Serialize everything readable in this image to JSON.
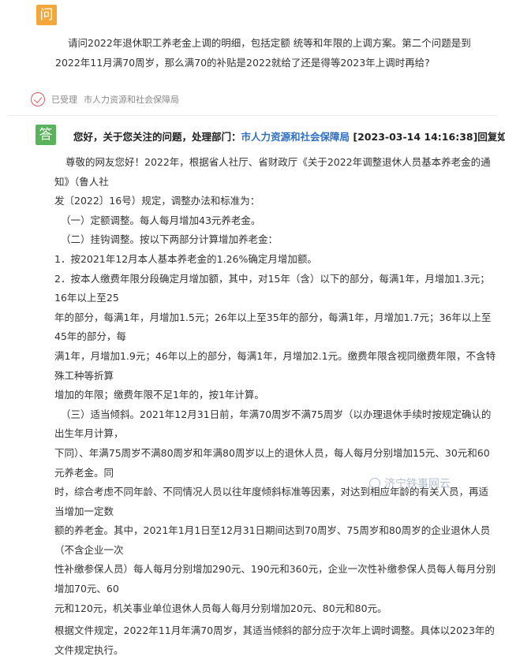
{
  "question": {
    "badge": "问",
    "lines": [
      "请问2022年退休职工养老金上调的明细，包括定额 统等和年限的上调方案。第二个问题是到2022年11月满70周",
      "岁，那么满70的补贴是2022就给了还是得等2023年上调时再给?"
    ]
  },
  "status": {
    "label": "已受理",
    "department": "市人力资源和社会保障局",
    "icon": "check-circle-icon",
    "color": "#e55a55"
  },
  "answer": {
    "badge": "答",
    "header_prefix": "您好，关于您关注的问题，处理部门：",
    "header_dept": "市人力资源和社会保障局",
    "header_time": " [2023-03-14 14:16:38]回复如下：",
    "paragraphs": [
      "尊敬的网友您好！2022年，根据省人社厅、省财政厅《关于2022年调整退休人员基本养老金的通知》（鲁人社",
      "发〔2022〕16号）规定，调整办法和标准为：",
      "（一）定额调整。每人每月增加43元养老金。",
      "（二）挂钩调整。按以下两部分计算增加养老金：",
      "1．按2021年12月本人基本养老金的1.26%确定月增加额。",
      "2．按本人缴费年限分段确定月增加额，其中，对15年（含）以下的部分，每满1年，月增加1.3元；16年以上至25",
      "年的部分，每满1年，月增加1.5元；26年以上至35年的部分，每满1年，月增加1.7元；36年以上至45年的部分，每",
      "满1年，月增加1.9元；46年以上的部分，每满1年，月增加2.1元。缴费年限含视同缴费年限，不含特殊工种等折算",
      "增加的年限；缴费年限不足1年的，按1年计算。",
      "（三）适当倾斜。2021年12月31日前，年满70周岁不满75周岁（以办理退休手续时按规定确认的出生年月计算，",
      "下同）、年满75周岁不满80周岁和年满80周岁以上的退休人员，每人每月分别增加15元、30元和60元养老金。同",
      "时，综合考虑不同年龄、不同情况人员以往年度倾斜标准等因素，对达到相应年龄的有关人员，再适当增加一定数",
      "额的养老金。其中，2021年1月1日至12月31日期间达到70周岁、75周岁和80周岁的企业退休人员（不含企业一次",
      "性补缴参保人员）每人每月分别增加290元、190元和360元，企业一次性补缴参保人员每人每月分别增加70元、60",
      "元和120元，机关事业单位退休人员每人每月分别增加20元、80元和80元。",
      "根据文件规定，2022年11月年满70周岁，其适当倾斜的部分应于次年上调时调整。具体以2023年的文件规定执行。"
    ]
  },
  "watermark": {
    "text": "济宁铁事网云",
    "icon": "watermark-logo-icon"
  }
}
